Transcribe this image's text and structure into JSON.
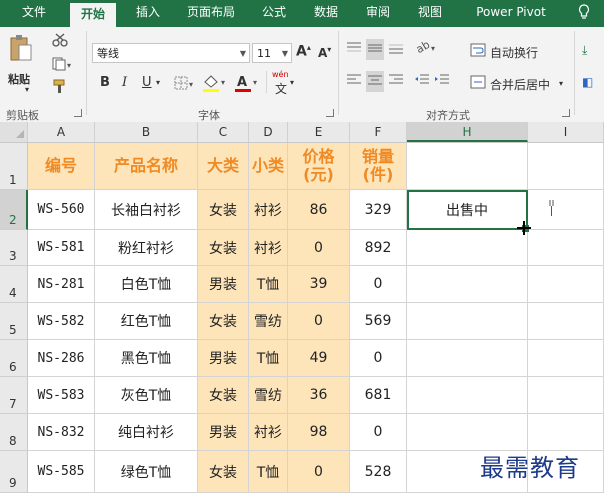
{
  "ribbon_tabs": [
    "文件",
    "开始",
    "插入",
    "页面布局",
    "公式",
    "数据",
    "审阅",
    "视图",
    "Power Pivot"
  ],
  "help_icon": "lightbulb-icon",
  "clipboard": {
    "paste_label": "粘贴",
    "group_label": "剪贴板"
  },
  "font": {
    "name": "等线",
    "size": "11",
    "group_label": "字体",
    "bold": "B",
    "italic": "I",
    "underline": "U",
    "grow": "A",
    "shrink": "A",
    "font_color_letter": "A",
    "phonetic": "wén",
    "phonetic_char": "文",
    "accent_yellow": "#ffff00",
    "accent_red": "#e00000"
  },
  "alignment": {
    "wrap_label": "自动换行",
    "merge_label": "合并后居中",
    "group_label": "对齐方式"
  },
  "columns": [
    "A",
    "B",
    "C",
    "D",
    "E",
    "F",
    "H",
    "I"
  ],
  "rows": [
    "1",
    "2",
    "3",
    "4",
    "5",
    "6",
    "7",
    "8",
    "9"
  ],
  "headers": {
    "a": "编号",
    "b": "产品名称",
    "c": "大类",
    "d": "小类",
    "e1": "价格",
    "e2": "(元)",
    "f1": "销量",
    "f2": "(件)"
  },
  "table": [
    [
      "WS-560",
      "长袖白衬衫",
      "女装",
      "衬衫",
      "86",
      "329"
    ],
    [
      "WS-581",
      "粉红衬衫",
      "女装",
      "衬衫",
      "0",
      "892"
    ],
    [
      "NS-281",
      "白色T恤",
      "男装",
      "T恤",
      "39",
      "0"
    ],
    [
      "WS-582",
      "红色T恤",
      "女装",
      "雪纺",
      "0",
      "569"
    ],
    [
      "NS-286",
      "黑色T恤",
      "男装",
      "T恤",
      "49",
      "0"
    ],
    [
      "WS-583",
      "灰色T恤",
      "女装",
      "雪纺",
      "36",
      "681"
    ],
    [
      "NS-832",
      "纯白衬衫",
      "男装",
      "衬衫",
      "98",
      "0"
    ],
    [
      "WS-585",
      "绿色T恤",
      "女装",
      "T恤",
      "0",
      "528"
    ]
  ],
  "active_cell_text": "出售中",
  "watermark": "最需教育",
  "colors": {
    "excel_green": "#217346",
    "header_fill": "#fde5b9",
    "header_text": "#f08a24"
  }
}
